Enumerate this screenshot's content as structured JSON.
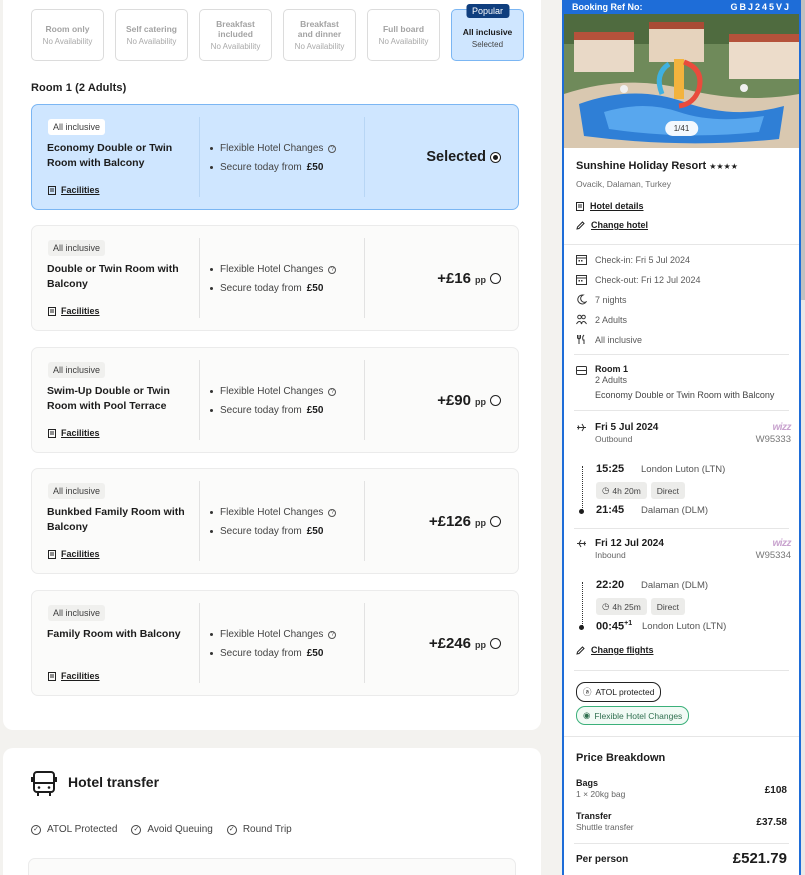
{
  "board_options": [
    {
      "name": "Room only",
      "availability": "No Availability",
      "active": false
    },
    {
      "name": "Self catering",
      "availability": "No Availability",
      "active": false
    },
    {
      "name": "Breakfast included",
      "availability": "No Availability",
      "active": false
    },
    {
      "name": "Breakfast and dinner",
      "availability": "No Availability",
      "active": false
    },
    {
      "name": "Full board",
      "availability": "No Availability",
      "active": false
    },
    {
      "name": "All inclusive",
      "availability": "Selected",
      "active": true,
      "badge": "Popular"
    }
  ],
  "room_heading": "Room 1 (2 Adults)",
  "rooms": [
    {
      "board": "All inclusive",
      "name": "Economy Double or Twin Room with Balcony",
      "facilities": "Facilities",
      "feature1": "Flexible Hotel Changes",
      "feature2_prefix": "Secure today from ",
      "feature2_amount": "£50",
      "price": "Selected",
      "per": "",
      "selected": true
    },
    {
      "board": "All inclusive",
      "name": "Double or Twin Room with Balcony",
      "facilities": "Facilities",
      "feature1": "Flexible Hotel Changes",
      "feature2_prefix": "Secure today from ",
      "feature2_amount": "£50",
      "price": "+£16",
      "per": "pp",
      "selected": false
    },
    {
      "board": "All inclusive",
      "name": "Swim-Up Double or Twin Room with Pool Terrace",
      "facilities": "Facilities",
      "feature1": "Flexible Hotel Changes",
      "feature2_prefix": "Secure today from ",
      "feature2_amount": "£50",
      "price": "+£90",
      "per": "pp",
      "selected": false
    },
    {
      "board": "All inclusive",
      "name": "Bunkbed Family Room with Balcony",
      "facilities": "Facilities",
      "feature1": "Flexible Hotel Changes",
      "feature2_prefix": "Secure today from ",
      "feature2_amount": "£50",
      "price": "+£126",
      "per": "pp",
      "selected": false
    },
    {
      "board": "All inclusive",
      "name": "Family Room with Balcony",
      "facilities": "Facilities",
      "feature1": "Flexible Hotel Changes",
      "feature2_prefix": "Secure today from ",
      "feature2_amount": "£50",
      "price": "+£246",
      "per": "pp",
      "selected": false
    }
  ],
  "transfer": {
    "title": "Hotel transfer",
    "features": [
      "ATOL Protected",
      "Avoid Queuing",
      "Round Trip"
    ]
  },
  "summary": {
    "booking_ref_label": "Booking Ref No:",
    "booking_ref": "GBJ245VJ",
    "image_counter": "1/41",
    "hotel_name": "Sunshine Holiday Resort",
    "stars": "★★★★",
    "location": "Ovacik, Dalaman, Turkey",
    "hotel_details": "Hotel details",
    "change_hotel": "Change hotel",
    "check_in": "Check-in: Fri 5 Jul 2024",
    "check_out": "Check-out: Fri 12 Jul 2024",
    "nights": "7 nights",
    "adults": "2 Adults",
    "board": "All inclusive",
    "room_title": "Room 1",
    "room_adults": "2 Adults",
    "room_type": "Economy Double or Twin Room with Balcony",
    "change_flights": "Change flights",
    "atol": "ATOL protected",
    "flex": "Flexible Hotel Changes"
  },
  "flights": {
    "outbound": {
      "date": "Fri 5 Jul 2024",
      "direction": "Outbound",
      "airline": "wizz",
      "code": "W95333",
      "dep_time": "15:25",
      "dep_airport": "London Luton (LTN)",
      "duration": "4h 20m",
      "stops": "Direct",
      "arr_time": "21:45",
      "arr_airport": "Dalaman (DLM)"
    },
    "inbound": {
      "date": "Fri 12 Jul 2024",
      "direction": "Inbound",
      "airline": "wizz",
      "code": "W95334",
      "dep_time": "22:20",
      "dep_airport": "Dalaman (DLM)",
      "duration": "4h 25m",
      "stops": "Direct",
      "arr_time": "00:45",
      "arr_sup": "+1",
      "arr_airport": "London Luton (LTN)"
    }
  },
  "price_breakdown": {
    "title": "Price Breakdown",
    "bags_label": "Bags",
    "bags_sub": "1 × 20kg bag",
    "bags_value": "£108",
    "transfer_label": "Transfer",
    "transfer_sub": "Shuttle transfer",
    "transfer_value": "£37.58",
    "per_person_label": "Per person",
    "per_person_value": "£521.79"
  }
}
